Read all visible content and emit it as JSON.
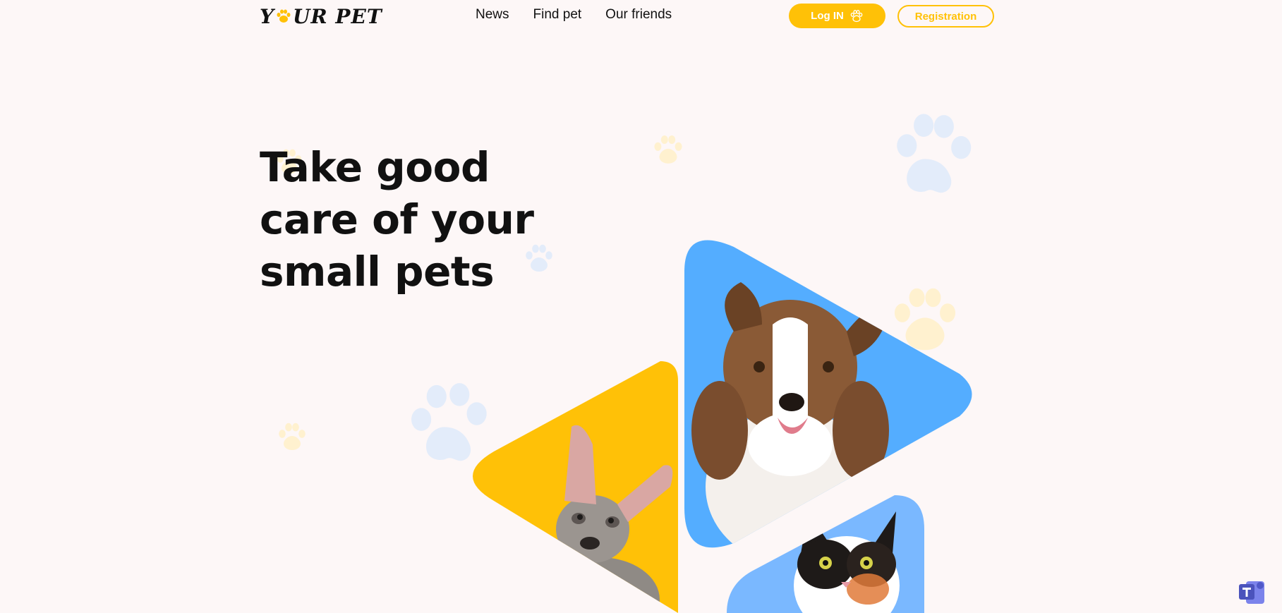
{
  "header": {
    "logo_text_start": "Y",
    "logo_text_end": "UR PET",
    "nav": [
      "News",
      "Find pet",
      "Our friends"
    ],
    "login_label": "Log IN",
    "registration_label": "Registration"
  },
  "hero": {
    "title": "Take good care of your small pets"
  },
  "colors": {
    "accent_yellow": "#ffc107",
    "accent_blue": "#54adff",
    "paw_blue": "#e3ecfa",
    "paw_yellow": "#fff1cf",
    "background": "#fdf7f7"
  },
  "icons": [
    "paw-icon",
    "teams-icon"
  ]
}
